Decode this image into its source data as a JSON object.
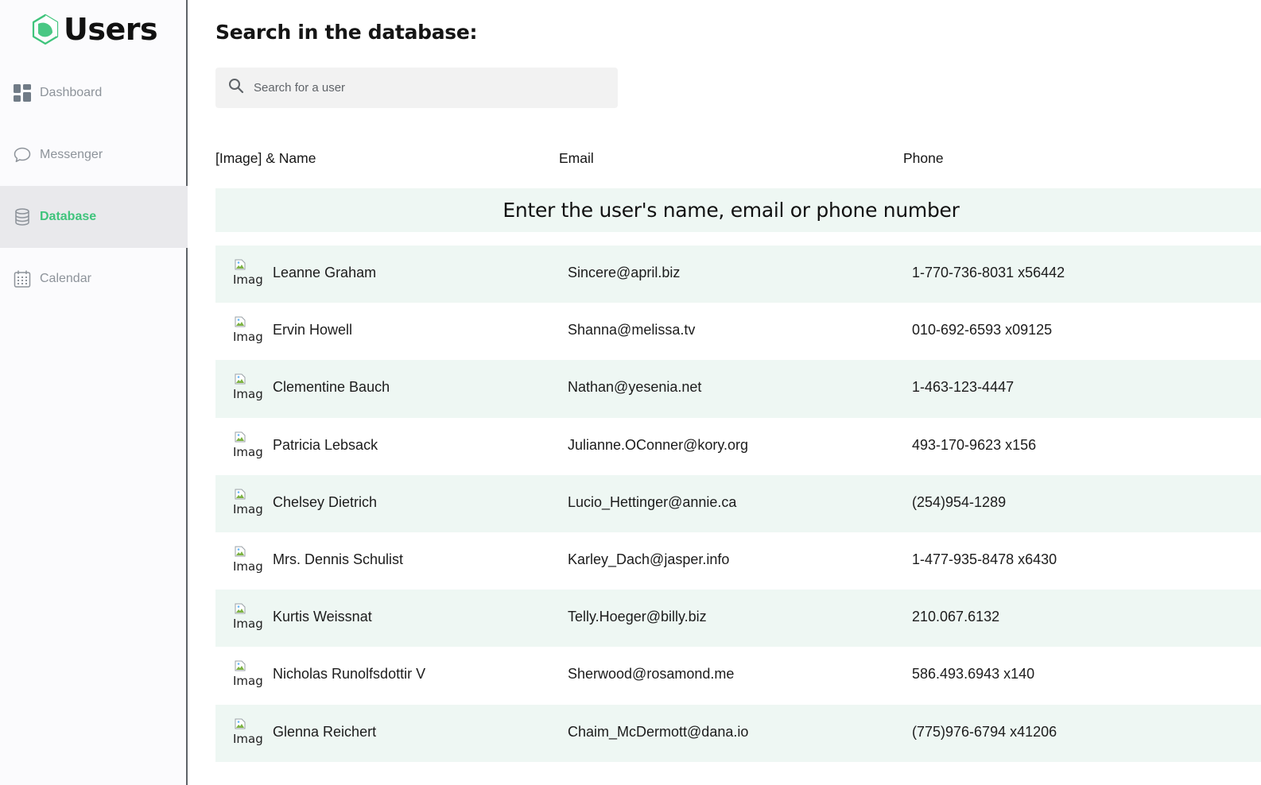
{
  "app": {
    "title": "Users",
    "accent_color": "#3fc47c"
  },
  "sidebar": {
    "items": [
      {
        "label": "Dashboard",
        "icon": "dashboard-icon",
        "active": false
      },
      {
        "label": "Messenger",
        "icon": "chat-bubble-icon",
        "active": false
      },
      {
        "label": "Database",
        "icon": "database-icon",
        "active": true
      },
      {
        "label": "Calendar",
        "icon": "calendar-icon",
        "active": false
      }
    ]
  },
  "main": {
    "title": "Search in the database:",
    "search": {
      "placeholder": "Search for a user",
      "value": "",
      "icon": "search-icon"
    },
    "columns": {
      "name": "[Image] & Name",
      "email": "Email",
      "phone": "Phone"
    },
    "hint": "Enter the user's name, email or phone number",
    "image_alt": "Image",
    "users": [
      {
        "name": "Leanne Graham",
        "email": "Sincere@april.biz",
        "phone": "1-770-736-8031 x56442"
      },
      {
        "name": "Ervin Howell",
        "email": "Shanna@melissa.tv",
        "phone": "010-692-6593 x09125"
      },
      {
        "name": "Clementine Bauch",
        "email": "Nathan@yesenia.net",
        "phone": "1-463-123-4447"
      },
      {
        "name": "Patricia Lebsack",
        "email": "Julianne.OConner@kory.org",
        "phone": "493-170-9623 x156"
      },
      {
        "name": "Chelsey Dietrich",
        "email": "Lucio_Hettinger@annie.ca",
        "phone": "(254)954-1289"
      },
      {
        "name": "Mrs. Dennis Schulist",
        "email": "Karley_Dach@jasper.info",
        "phone": "1-477-935-8478 x6430"
      },
      {
        "name": "Kurtis Weissnat",
        "email": "Telly.Hoeger@billy.biz",
        "phone": "210.067.6132"
      },
      {
        "name": "Nicholas Runolfsdottir V",
        "email": "Sherwood@rosamond.me",
        "phone": "586.493.6943 x140"
      },
      {
        "name": "Glenna Reichert",
        "email": "Chaim_McDermott@dana.io",
        "phone": "(775)976-6794 x41206"
      }
    ]
  }
}
